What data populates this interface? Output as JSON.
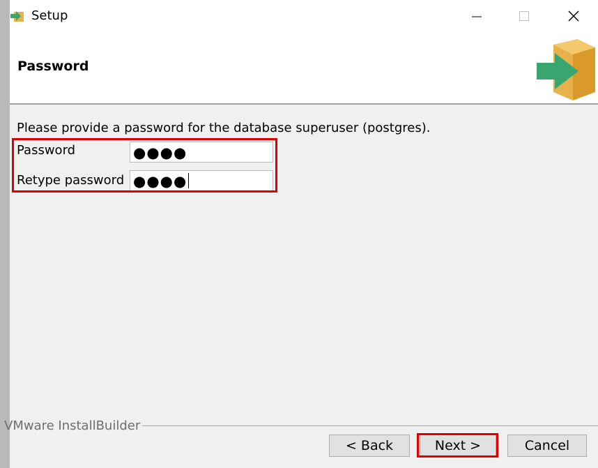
{
  "window": {
    "title": "Setup",
    "icon": "setup-arrow-icon",
    "controls": {
      "minimize": "─",
      "maximize": "☐",
      "close": "✕"
    }
  },
  "header": {
    "title": "Password",
    "logo": "installer-box-logo"
  },
  "form": {
    "instructions": "Please provide a password for the database superuser (postgres).",
    "password_label": "Password",
    "password_value": "●●●●",
    "retype_label": "Retype password",
    "retype_value": "●●●●"
  },
  "footer": {
    "brand": "VMware InstallBuilder",
    "back_label": "< Back",
    "next_label": "Next >",
    "cancel_label": "Cancel"
  },
  "colors": {
    "highlight": "#e00000",
    "logo_box": "#e8b14a",
    "logo_arrow": "#3aa66f"
  }
}
